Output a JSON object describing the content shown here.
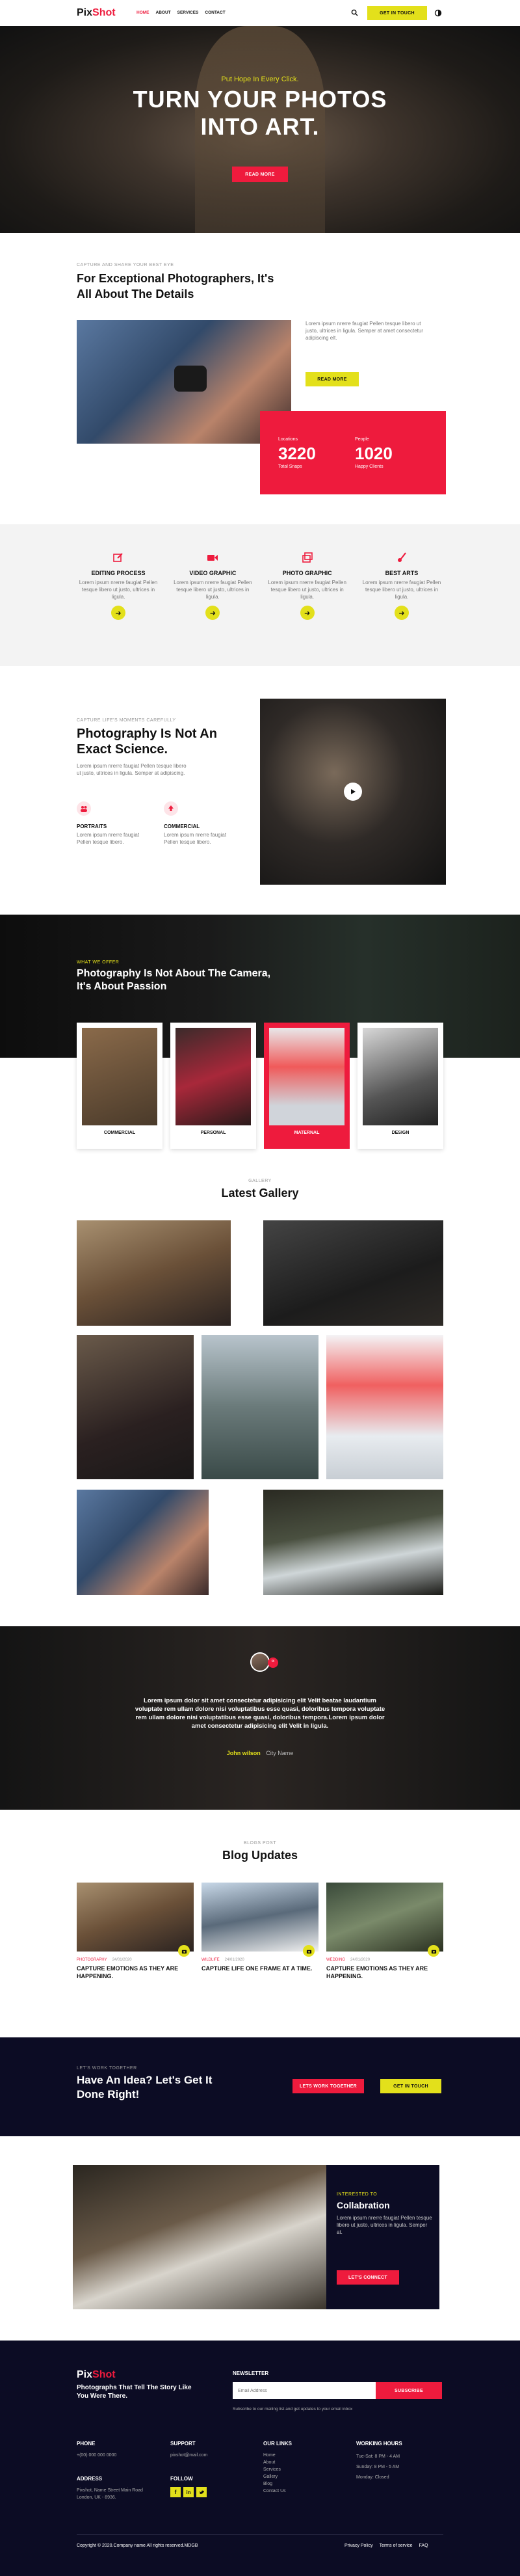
{
  "header": {
    "logo_part1": "Pix",
    "logo_part2": "Shot",
    "nav": [
      "HOME",
      "ABOUT",
      "SERVICES",
      "CONTACT"
    ],
    "cta": "GET IN TOUCH"
  },
  "hero": {
    "eyebrow": "Put Hope In Every Click.",
    "title_line1": "TURN YOUR PHOTOS",
    "title_line2": "INTO ART.",
    "button": "READ MORE"
  },
  "about": {
    "kicker": "CAPTURE AND SHARE YOUR BEST EYE",
    "title_line1": "For Exceptional Photographers, It's",
    "title_line2": "All About The Details",
    "text": "Lorem ipsum nrerre faugiat Pellen tesque libero ut justo, ultrices in ligula. Semper at amet consectetur adipiscing elt.",
    "button": "READ MORE",
    "stat1_label_top": "Locations",
    "stat1_value": "3220",
    "stat1_label": "Total Snaps",
    "stat2_label_top": "People",
    "stat2_value": "1020",
    "stat2_label": "Happy Clients"
  },
  "services": [
    {
      "title": "EDITING PROCESS",
      "text": "Lorem ipsum nrerre faugiat Pellen tesque libero ut justo, ultrices in ligula."
    },
    {
      "title": "VIDEO GRAPHIC",
      "text": "Lorem ipsum nrerre faugiat Pellen tesque libero ut justo, ultrices in ligula."
    },
    {
      "title": "PHOTO GRAPHIC",
      "text": "Lorem ipsum nrerre faugiat Pellen tesque libero ut justo, ultrices in ligula."
    },
    {
      "title": "BEST ARTS",
      "text": "Lorem ipsum nrerre faugiat Pellen tesque libero ut justo, ultrices in ligula."
    }
  ],
  "science": {
    "kicker": "CAPTURE LIFE'S MOMENTS CAREFULLY",
    "title_line1": "Photography Is Not An",
    "title_line2": "Exact Science.",
    "text": "Lorem ipsum nrerre faugiat Pellen tesque libero ut justo, ultrices in ligula. Semper at adipiscing.",
    "feature1_title": "PORTRAITS",
    "feature1_text": "Lorem ipsum nrerre faugiat Pellen tesque libero.",
    "feature2_title": "COMMERCIAL",
    "feature2_text": "Lorem ipsum nrerre faugiat Pellen tesque libero."
  },
  "offer": {
    "kicker": "WHAT WE OFFER",
    "title_line1": "Photography Is Not About The Camera,",
    "title_line2": "It's About Passion",
    "cards": [
      "COMMERCIAL",
      "PERSONAL",
      "MATERNAL",
      "DESIGN"
    ]
  },
  "gallery": {
    "kicker": "GALLERY",
    "title": "Latest Gallery"
  },
  "testimonial": {
    "quote": "Lorem ipsum dolor sit amet consectetur adipisicing elit Velit beatae laudantium voluptate rem ullam dolore nisi voluptatibus esse quasi, doloribus tempora voluptate rem ullam dolore nisi voluptatibus esse quasi, doloribus tempora.Lorem ipsum dolor amet consectetur adipisicing elit Velit in ligula.",
    "name": "John wilson",
    "role": "City Name"
  },
  "blog": {
    "kicker": "BLOGS POST",
    "title": "Blog Updates",
    "posts": [
      {
        "category": "PHOTOGRAPHY",
        "date": "24/01/2020",
        "title": "CAPTURE EMOTIONS AS THEY ARE HAPPENING."
      },
      {
        "category": "WILDLIFE",
        "date": "24/01/2020",
        "title": "CAPTURE LIFE ONE FRAME AT A TIME."
      },
      {
        "category": "WEDDING",
        "date": "24/01/2020",
        "title": "CAPTURE EMOTIONS AS THEY ARE HAPPENING."
      }
    ]
  },
  "cta": {
    "kicker": "LET'S WORK TOGETHER",
    "title_line1": "Have An Idea? Let's Get It",
    "title_line2": "Done Right!",
    "button1": "LETS WORK TOGETHER",
    "button2": "GET IN TOUCH"
  },
  "collab": {
    "kicker": "INTERESTED TO",
    "title": "Collabration",
    "text": "Lorem ipsum nrerre faugiat Pellen tesque libero ut justo, ultrices in ligula. Semper at.",
    "button": "LET'S CONNECT"
  },
  "footer": {
    "tagline": "Photographs That Tell The Story Like You Were There.",
    "newsletter_title": "NEWSLETTER",
    "email_placeholder": "Email Address",
    "subscribe": "SUBSCRIBE",
    "newsletter_note": "Subscribe to our mailing list and get updates to your email inbox",
    "phone_title": "PHONE",
    "phone": "+(00) 000 000 0000",
    "support_title": "SUPPORT",
    "support_email": "pixshot@mail.com",
    "links_title": "OUR LINKS",
    "links": [
      "Home",
      "About",
      "Services",
      "Gallery",
      "Blog",
      "Contact Us"
    ],
    "hours_title": "WORKING HOURS",
    "hours": [
      "Tue-Sat: 8 PM - 4 AM",
      "Sunday: 8 PM - 5 AM",
      "Monday: Closed"
    ],
    "address_title": "ADDRESS",
    "address": "Pixshot, Name Street Main Road London, UK - 8936.",
    "follow_title": "FOLLOW",
    "copyright": "Copyright © 2020.Company name All rights reserved.MDGB",
    "bottom_links": [
      "Privacy Policy",
      "Terms of service",
      "FAQ"
    ]
  },
  "colors": {
    "accent_red": "#ee1b3d",
    "accent_yellow": "#e3e01b",
    "navy": "#0c0c24"
  }
}
